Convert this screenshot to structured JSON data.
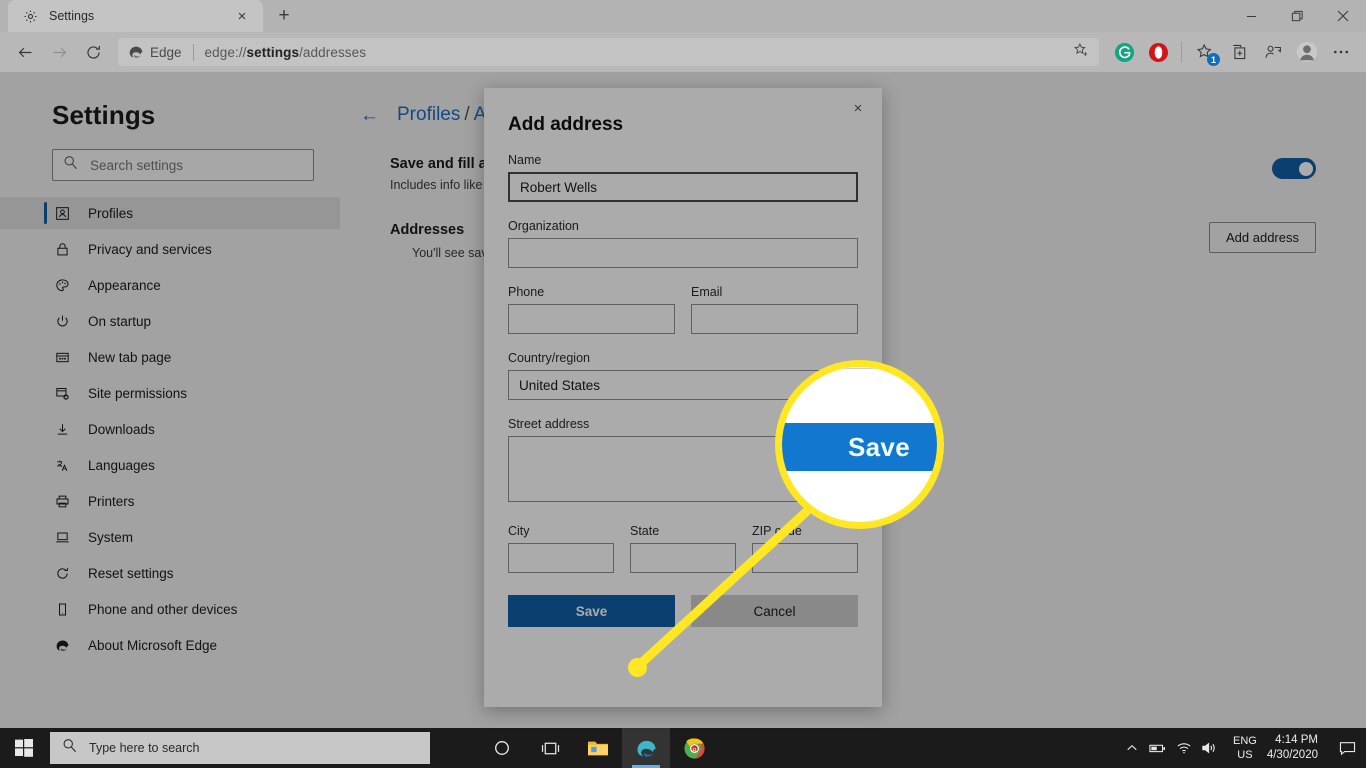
{
  "browser": {
    "tab": {
      "title": "Settings",
      "favicon": "gear-icon",
      "close": "×"
    },
    "new_tab_label": "+",
    "window_controls": {
      "minimize": "—",
      "restore": "❐",
      "close": "✕"
    },
    "omnibox": {
      "brand_label": "Edge",
      "url_prefix": "edge://",
      "url_bold": "settings",
      "url_suffix": "/addresses"
    },
    "extensions": [
      {
        "name": "grammarly-extension-icon",
        "letter": "G",
        "color": "#11a683"
      },
      {
        "name": "opera-extension-icon",
        "letter": "O",
        "color": "#d7131a"
      }
    ],
    "favorites_badge": "1"
  },
  "settings": {
    "title": "Settings",
    "search": {
      "placeholder": "Search settings"
    },
    "nav_items": [
      {
        "label": "Profiles",
        "icon": "profiles-icon",
        "active": true
      },
      {
        "label": "Privacy and services",
        "icon": "lock-icon",
        "active": false
      },
      {
        "label": "Appearance",
        "icon": "palette-icon",
        "active": false
      },
      {
        "label": "On startup",
        "icon": "power-icon",
        "active": false
      },
      {
        "label": "New tab page",
        "icon": "newtab-icon",
        "active": false
      },
      {
        "label": "Site permissions",
        "icon": "permissions-icon",
        "active": false
      },
      {
        "label": "Downloads",
        "icon": "download-icon",
        "active": false
      },
      {
        "label": "Languages",
        "icon": "languages-icon",
        "active": false
      },
      {
        "label": "Printers",
        "icon": "printer-icon",
        "active": false
      },
      {
        "label": "System",
        "icon": "system-icon",
        "active": false
      },
      {
        "label": "Reset settings",
        "icon": "reset-icon",
        "active": false
      },
      {
        "label": "Phone and other devices",
        "icon": "phone-icon",
        "active": false
      },
      {
        "label": "About Microsoft Edge",
        "icon": "edge-logo-icon",
        "active": false
      }
    ],
    "breadcrumb": {
      "back": "←",
      "parent": "Profiles",
      "separator": "/",
      "current": "A"
    },
    "save_fill": {
      "heading": "Save and fill ad",
      "subtext": "Includes info like",
      "toggle_on": true
    },
    "addresses": {
      "heading": "Addresses",
      "subtext": "You'll see sav",
      "add_button": "Add address"
    }
  },
  "dialog": {
    "title": "Add address",
    "close": "×",
    "fields": {
      "name": {
        "label": "Name",
        "value": "Robert Wells",
        "placeholder": "",
        "focused": true
      },
      "organization": {
        "label": "Organization",
        "value": "",
        "placeholder": ""
      },
      "phone": {
        "label": "Phone",
        "value": "",
        "placeholder": ""
      },
      "email": {
        "label": "Email",
        "value": "",
        "placeholder": ""
      },
      "country": {
        "label": "Country/region",
        "value": "United States",
        "placeholder": ""
      },
      "street": {
        "label": "Street address",
        "value": "",
        "placeholder": ""
      },
      "city": {
        "label": "City",
        "value": "",
        "placeholder": ""
      },
      "state": {
        "label": "State",
        "value": "",
        "placeholder": ""
      },
      "zip": {
        "label": "ZIP code",
        "value": "",
        "placeholder": ""
      }
    },
    "save_label": "Save",
    "cancel_label": "Cancel"
  },
  "callout": {
    "magnified_label": "Save",
    "ring_color": "#ffe823",
    "button_color": "#1277ce"
  },
  "taskbar": {
    "start": "windows-logo-icon",
    "search_placeholder": "Type here to search",
    "apps": [
      {
        "name": "cortana-icon"
      },
      {
        "name": "task-view-icon"
      },
      {
        "name": "file-explorer-icon"
      },
      {
        "name": "edge-icon"
      },
      {
        "name": "chrome-icon"
      }
    ],
    "tray": {
      "language_line1": "ENG",
      "language_line2": "US",
      "time": "4:14 PM",
      "date": "4/30/2020"
    }
  }
}
